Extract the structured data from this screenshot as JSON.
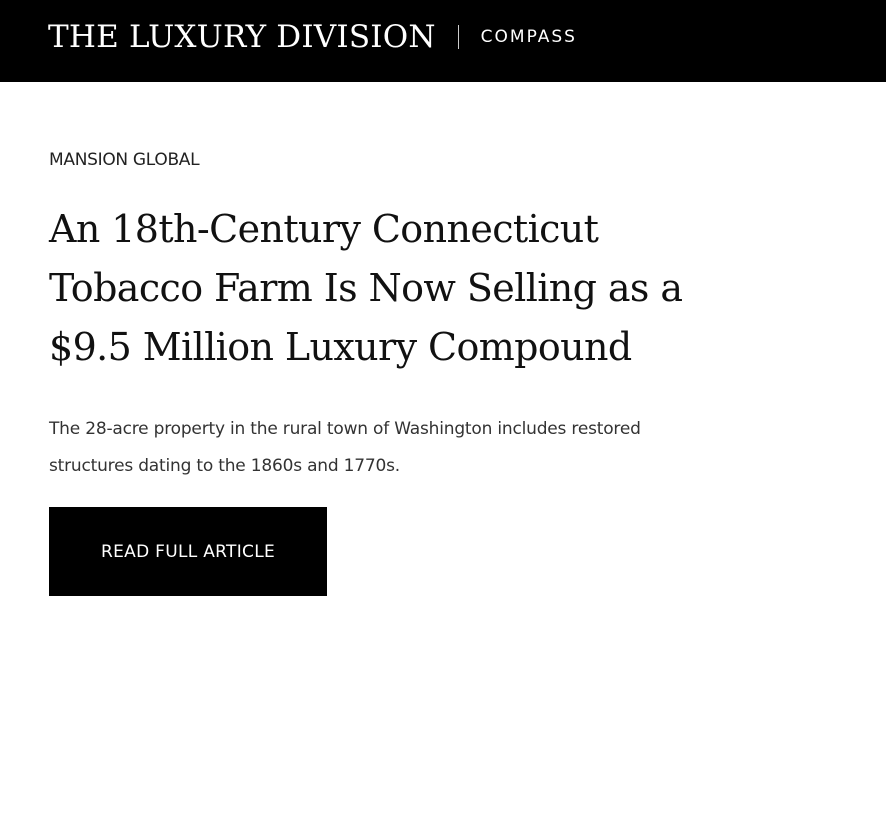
{
  "header": {
    "title": "THE LUXURY DIVISION",
    "partner": "COMPASS"
  },
  "article": {
    "source": "MANSION GLOBAL",
    "headline": "An 18th-Century Connecticut Tobacco Farm Is Now Selling as a $9.5 Million Luxury Compound",
    "summary": "The 28-acre property in the rural town of Washington includes restored structures dating to the 1860s and 1770s.",
    "cta_label": "READ FULL ARTICLE"
  },
  "colors": {
    "header_bg": "#000000",
    "button_bg": "#000000",
    "text": "#111111"
  }
}
